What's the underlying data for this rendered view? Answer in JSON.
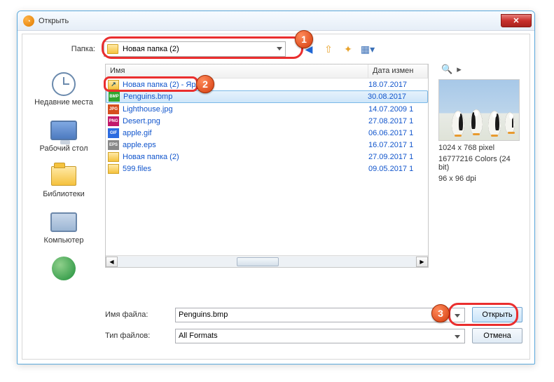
{
  "titlebar": {
    "title": "Открыть"
  },
  "toprow": {
    "folder_label": "Папка:",
    "folder_value": "Новая папка (2)"
  },
  "sidebar": {
    "items": [
      {
        "label": "Недавние места"
      },
      {
        "label": "Рабочий стол"
      },
      {
        "label": "Библиотеки"
      },
      {
        "label": "Компьютер"
      },
      {
        "label": ""
      }
    ]
  },
  "filelist": {
    "columns": {
      "name": "Имя",
      "date": "Дата измен"
    },
    "rows": [
      {
        "icon": "shortcut",
        "name": "Новая папка (2) - Ярлык",
        "date": "18.07.2017"
      },
      {
        "icon": "bmp",
        "name": "Penguins.bmp",
        "date": "30.08.2017",
        "selected": true
      },
      {
        "icon": "jpg",
        "name": "Lighthouse.jpg",
        "date": "14.07.2009 1"
      },
      {
        "icon": "png",
        "name": "Desert.png",
        "date": "27.08.2017 1"
      },
      {
        "icon": "gif",
        "name": "apple.gif",
        "date": "06.06.2017 1"
      },
      {
        "icon": "eps",
        "name": "apple.eps",
        "date": "16.07.2017 1"
      },
      {
        "icon": "folder",
        "name": "Новая папка (2)",
        "date": "27.09.2017 1"
      },
      {
        "icon": "folder",
        "name": "599.files",
        "date": "09.05.2017 1"
      }
    ]
  },
  "preview": {
    "dims": "1024 x 768 pixel",
    "colors": "16777216 Colors (24 bit)",
    "dpi": "96 x 96 dpi"
  },
  "bottom": {
    "filename_label": "Имя файла:",
    "filename_value": "Penguins.bmp",
    "filetype_label": "Тип файлов:",
    "filetype_value": "All Formats",
    "open_label": "Открыть",
    "cancel_label": "Отмена"
  },
  "callouts": {
    "n1": "1",
    "n2": "2",
    "n3": "3"
  },
  "icon_colors": {
    "bmp": "#2fa52f",
    "jpg": "#d64e1e",
    "png": "#c2186a",
    "gif": "#2b6be0",
    "eps": "#888"
  }
}
